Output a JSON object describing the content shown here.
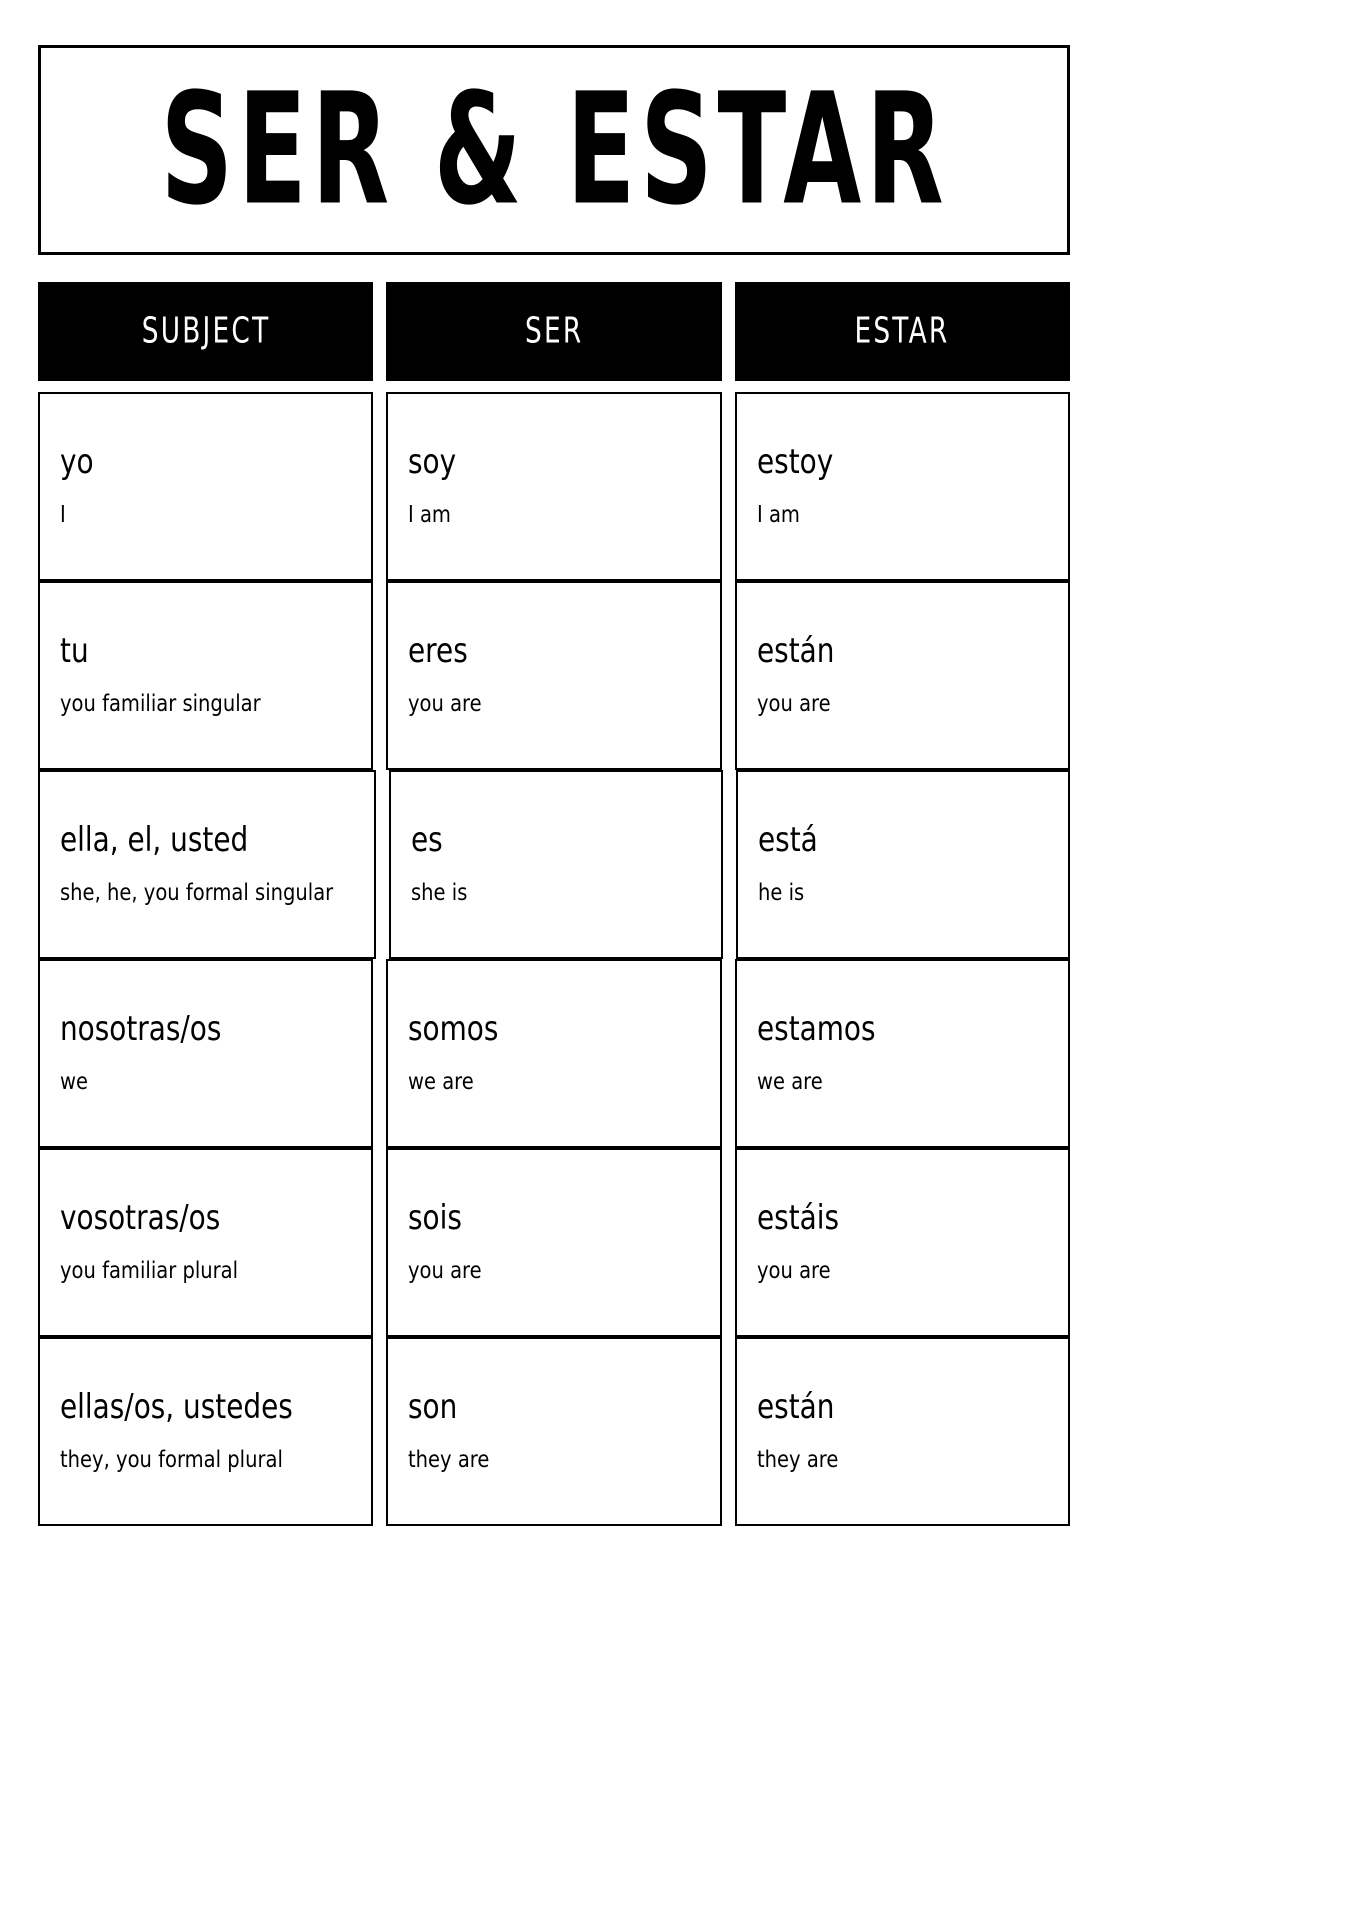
{
  "title": "SER & ESTAR",
  "table": {
    "columns": [
      "SUBJECT",
      "SER",
      "ESTAR"
    ],
    "rows": [
      {
        "subject": {
          "term": "yo",
          "gloss": "I"
        },
        "ser": {
          "term": "soy",
          "gloss": "I am"
        },
        "estar": {
          "term": "estoy",
          "gloss": "I am"
        }
      },
      {
        "subject": {
          "term": "tu",
          "gloss": "you familiar singular"
        },
        "ser": {
          "term": "eres",
          "gloss": "you are"
        },
        "estar": {
          "term": "están",
          "gloss": "you are"
        }
      },
      {
        "subject": {
          "term": "ella, el, usted",
          "gloss": "she, he, you formal singular"
        },
        "ser": {
          "term": "es",
          "gloss": "she is"
        },
        "estar": {
          "term": "está",
          "gloss": "he is"
        }
      },
      {
        "subject": {
          "term": "nosotras/os",
          "gloss": "we"
        },
        "ser": {
          "term": "somos",
          "gloss": "we are"
        },
        "estar": {
          "term": "estamos",
          "gloss": "we are"
        }
      },
      {
        "subject": {
          "term": "vosotras/os",
          "gloss": "you familiar plural"
        },
        "ser": {
          "term": "sois",
          "gloss": "you are"
        },
        "estar": {
          "term": "estáis",
          "gloss": "you are"
        }
      },
      {
        "subject": {
          "term": "ellas/os, ustedes",
          "gloss": "they, you formal plural"
        },
        "ser": {
          "term": "son",
          "gloss": "they are"
        },
        "estar": {
          "term": "están",
          "gloss": "they are"
        }
      }
    ]
  },
  "colors": {
    "header_background": "#000000",
    "header_text": "#ffffff",
    "page_background": "#ffffff",
    "border": "#000000",
    "body_text": "#000000"
  }
}
